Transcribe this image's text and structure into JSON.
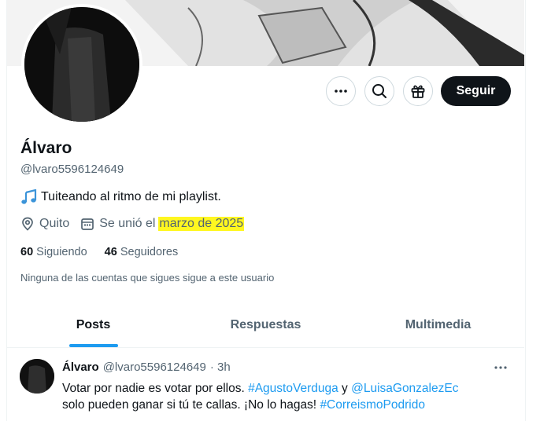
{
  "profile": {
    "name": "Álvaro",
    "handle": "@lvaro5596124649",
    "bio": "Tuiteando al ritmo de mi playlist.",
    "location": "Quito",
    "joined_prefix": "Se unió el",
    "joined_date": "marzo de 2025",
    "following_count": "60",
    "following_label": "Siguiendo",
    "followers_count": "46",
    "followers_label": "Seguidores",
    "notice": "Ninguna de las cuentas que sigues sigue a este usuario"
  },
  "actions": {
    "follow_label": "Seguir"
  },
  "tabs": [
    {
      "label": "Posts",
      "active": true
    },
    {
      "label": "Respuestas",
      "active": false
    },
    {
      "label": "Multimedia",
      "active": false
    }
  ],
  "tweet": {
    "author": "Álvaro",
    "handle": "@lvaro5596124649",
    "time": "· 3h",
    "text_1": "Votar por nadie es votar por ellos.",
    "hashtag_1": "#AgustoVerduga",
    "conjunction": "y",
    "mention": "@LuisaGonzalezEc",
    "text_2": "solo pueden ganar si tú te callas. ¡No lo hagas!",
    "hashtag_2": "#CorreismoPodrido"
  },
  "colors": {
    "accent": "#1d9bf0",
    "highlight": "#fff720",
    "text_primary": "#0f1419",
    "text_secondary": "#536471"
  }
}
